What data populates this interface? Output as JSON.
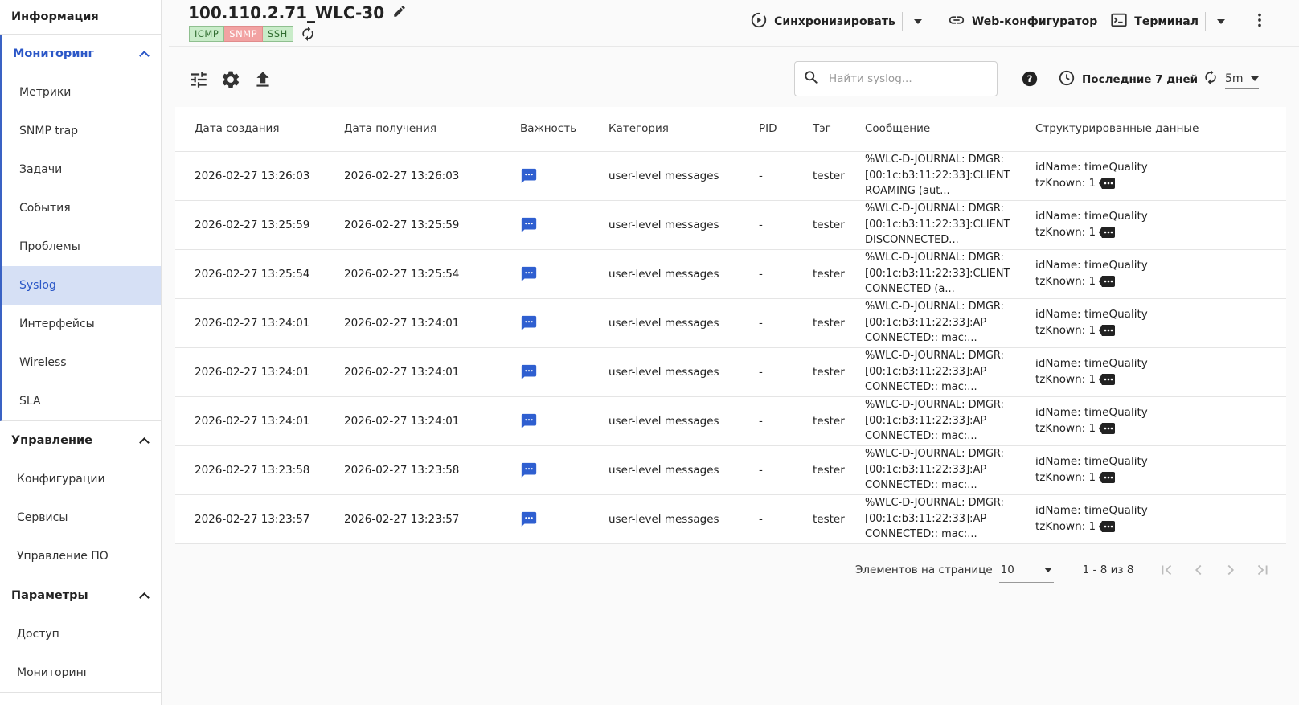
{
  "sidebar": {
    "info_label": "Информация",
    "groups": [
      {
        "title": "Мониторинг",
        "items": [
          "Метрики",
          "SNMP trap",
          "Задачи",
          "События",
          "Проблемы",
          "Syslog",
          "Интерфейсы",
          "Wireless",
          "SLA"
        ]
      },
      {
        "title": "Управление",
        "items": [
          "Конфигурации",
          "Сервисы",
          "Управление ПО"
        ]
      },
      {
        "title": "Параметры",
        "items": [
          "Доступ",
          "Мониторинг"
        ]
      }
    ],
    "active_item": "Syslog"
  },
  "header": {
    "device_name": "100.110.2.71_WLC-30",
    "badges": [
      {
        "label": "ICMP",
        "status": "ok"
      },
      {
        "label": "SNMP",
        "status": "error"
      },
      {
        "label": "SSH",
        "status": "ok"
      }
    ],
    "sync_label": "Синхронизировать",
    "web_config_label": "Web-конфигуратор",
    "terminal_label": "Терминал"
  },
  "toolbar": {
    "search_placeholder": "Найти syslog...",
    "period_label": "Последние 7 дней",
    "refresh_interval": "5m"
  },
  "table": {
    "columns": [
      "Дата создания",
      "Дата получения",
      "Важность",
      "Категория",
      "PID",
      "Тэг",
      "Сообщение",
      "Структурированные данные"
    ],
    "rows": [
      {
        "created": "2026-02-27 13:26:03",
        "received": "2026-02-27 13:26:03",
        "severity": "info",
        "category": "user-level messages",
        "pid": "-",
        "tag": "tester",
        "message": "%WLC-D-JOURNAL: DMGR: [00:1c:b3:11:22:33]:CLIENT ROAMING (aut...",
        "sd_line1": "idName: timeQuality",
        "sd_line2": "tzKnown: 1"
      },
      {
        "created": "2026-02-27 13:25:59",
        "received": "2026-02-27 13:25:59",
        "severity": "info",
        "category": "user-level messages",
        "pid": "-",
        "tag": "tester",
        "message": "%WLC-D-JOURNAL: DMGR: [00:1c:b3:11:22:33]:CLIENT DISCONNECTED...",
        "sd_line1": "idName: timeQuality",
        "sd_line2": "tzKnown: 1"
      },
      {
        "created": "2026-02-27 13:25:54",
        "received": "2026-02-27 13:25:54",
        "severity": "info",
        "category": "user-level messages",
        "pid": "-",
        "tag": "tester",
        "message": "%WLC-D-JOURNAL: DMGR: [00:1c:b3:11:22:33]:CLIENT CONNECTED (a...",
        "sd_line1": "idName: timeQuality",
        "sd_line2": "tzKnown: 1"
      },
      {
        "created": "2026-02-27 13:24:01",
        "received": "2026-02-27 13:24:01",
        "severity": "info",
        "category": "user-level messages",
        "pid": "-",
        "tag": "tester",
        "message": "%WLC-D-JOURNAL: DMGR: [00:1c:b3:11:22:33]:AP CONNECTED:: mac:...",
        "sd_line1": "idName: timeQuality",
        "sd_line2": "tzKnown: 1"
      },
      {
        "created": "2026-02-27 13:24:01",
        "received": "2026-02-27 13:24:01",
        "severity": "info",
        "category": "user-level messages",
        "pid": "-",
        "tag": "tester",
        "message": "%WLC-D-JOURNAL: DMGR: [00:1c:b3:11:22:33]:AP CONNECTED:: mac:...",
        "sd_line1": "idName: timeQuality",
        "sd_line2": "tzKnown: 1"
      },
      {
        "created": "2026-02-27 13:24:01",
        "received": "2026-02-27 13:24:01",
        "severity": "info",
        "category": "user-level messages",
        "pid": "-",
        "tag": "tester",
        "message": "%WLC-D-JOURNAL: DMGR: [00:1c:b3:11:22:33]:AP CONNECTED:: mac:...",
        "sd_line1": "idName: timeQuality",
        "sd_line2": "tzKnown: 1"
      },
      {
        "created": "2026-02-27 13:23:58",
        "received": "2026-02-27 13:23:58",
        "severity": "info",
        "category": "user-level messages",
        "pid": "-",
        "tag": "tester",
        "message": "%WLC-D-JOURNAL: DMGR: [00:1c:b3:11:22:33]:AP CONNECTED:: mac:...",
        "sd_line1": "idName: timeQuality",
        "sd_line2": "tzKnown: 1"
      },
      {
        "created": "2026-02-27 13:23:57",
        "received": "2026-02-27 13:23:57",
        "severity": "info",
        "category": "user-level messages",
        "pid": "-",
        "tag": "tester",
        "message": "%WLC-D-JOURNAL: DMGR: [00:1c:b3:11:22:33]:AP CONNECTED:: mac:...",
        "sd_line1": "idName: timeQuality",
        "sd_line2": "tzKnown: 1"
      }
    ]
  },
  "paginator": {
    "per_page_label": "Элементов на странице",
    "per_page_value": "10",
    "range_label": "1 - 8 из 8"
  },
  "colors": {
    "accent": "#2b57c7",
    "active_bg": "#d6e0f5",
    "severity_info": "#2f5fd0",
    "badge_ok_bg": "#c9ecc9",
    "badge_err_bg": "#f2a2a2"
  },
  "icons": {
    "edit": "pencil-icon",
    "sync": "sync-play-icon",
    "web": "link-icon",
    "terminal": "terminal-icon",
    "more": "more-vertical-icon",
    "filters": "tune-icon",
    "settings": "gear-icon",
    "export": "upload-icon",
    "search": "search-icon",
    "help": "help-circle-icon",
    "period": "clock-icon",
    "refresh": "refresh-icon",
    "severity": "message-info-icon"
  }
}
